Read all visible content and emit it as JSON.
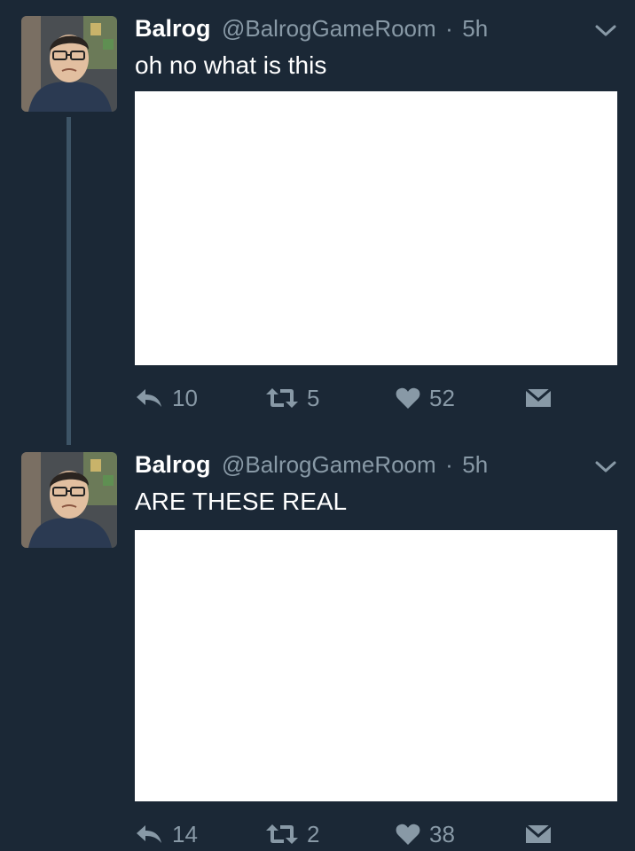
{
  "tweets": [
    {
      "name": "Balrog",
      "handle": "@BalrogGameRoom",
      "separator": "·",
      "time": "5h",
      "text": "oh no what is this",
      "replies": "10",
      "retweets": "5",
      "likes": "52",
      "icons": {
        "reply": "reply-icon",
        "retweet": "retweet-icon",
        "like": "heart-icon",
        "dm": "envelope-icon",
        "more": "chevron-down-icon"
      }
    },
    {
      "name": "Balrog",
      "handle": "@BalrogGameRoom",
      "separator": "·",
      "time": "5h",
      "text": "ARE THESE REAL",
      "replies": "14",
      "retweets": "2",
      "likes": "38",
      "icons": {
        "reply": "reply-icon",
        "retweet": "retweet-icon",
        "like": "heart-icon",
        "dm": "envelope-icon",
        "more": "chevron-down-icon"
      }
    }
  ],
  "colors": {
    "background": "#1b2836",
    "secondary_text": "#8899a6",
    "thread_line": "#3d5466",
    "primary_text": "#ffffff"
  }
}
